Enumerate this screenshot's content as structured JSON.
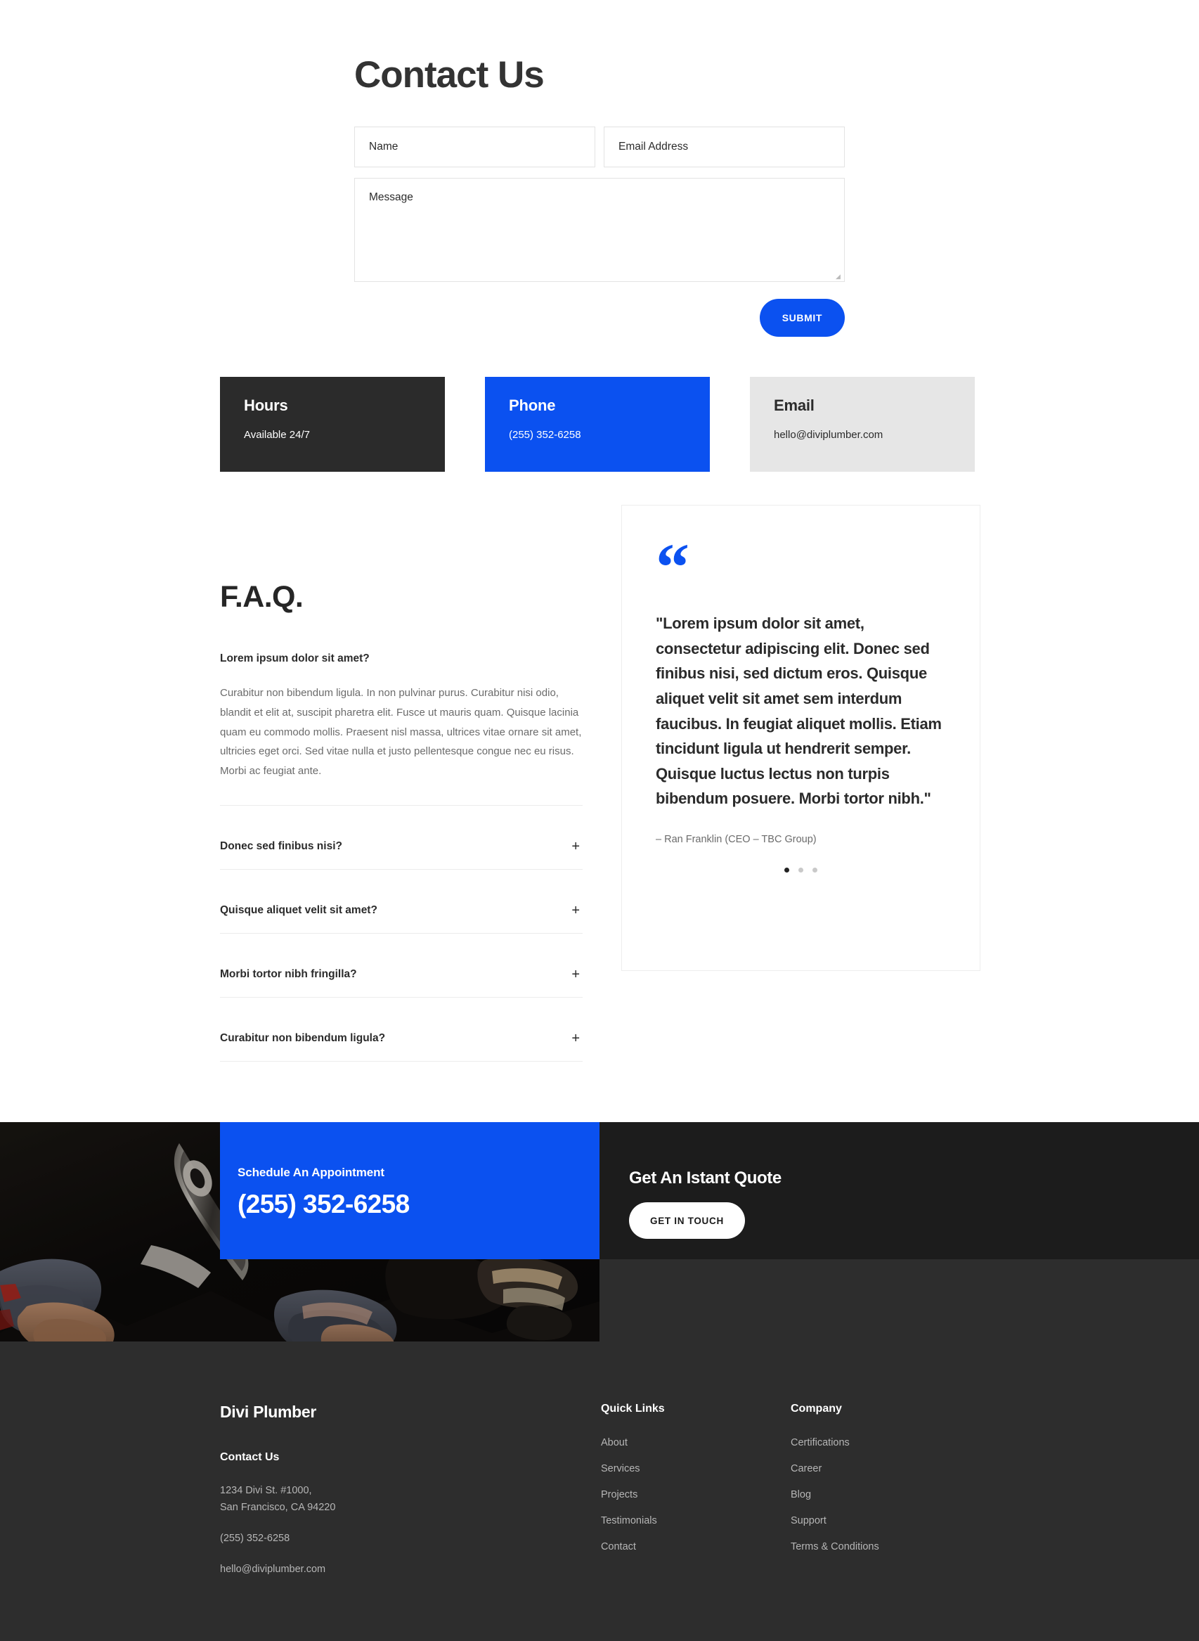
{
  "contact": {
    "title": "Contact Us",
    "form": {
      "name_placeholder": "Name",
      "email_placeholder": "Email Address",
      "message_placeholder": "Message",
      "submit_label": "SUBMIT"
    }
  },
  "info_cards": [
    {
      "heading": "Hours",
      "value": "Available 24/7",
      "style": "dark"
    },
    {
      "heading": "Phone",
      "value": "(255) 352-6258",
      "style": "blue"
    },
    {
      "heading": "Email",
      "value": "hello@diviplumber.com",
      "style": "light"
    }
  ],
  "faq": {
    "title": "F.A.Q.",
    "open_item": {
      "question": "Lorem ipsum dolor sit amet?",
      "answer": "Curabitur non bibendum ligula. In non pulvinar purus. Curabitur nisi odio, blandit et elit at, suscipit pharetra elit. Fusce ut mauris quam. Quisque lacinia quam eu commodo mollis. Praesent nisl massa, ultrices vitae ornare sit amet, ultricies eget orci. Sed vitae nulla et justo pellentesque congue nec eu risus. Morbi ac feugiat ante."
    },
    "items": [
      {
        "question": "Donec sed finibus nisi?",
        "toggle": "+"
      },
      {
        "question": "Quisque aliquet velit sit amet?",
        "toggle": "+"
      },
      {
        "question": "Morbi tortor nibh fringilla?",
        "toggle": "+"
      },
      {
        "question": "Curabitur non bibendum ligula?",
        "toggle": "+"
      }
    ]
  },
  "testimonial": {
    "quote_glyph": "“",
    "text": "\"Lorem ipsum dolor sit amet, consectetur adipiscing elit. Donec sed finibus nisi, sed dictum eros. Quisque aliquet velit sit amet sem interdum faucibus. In feugiat aliquet mollis. Etiam tincidunt ligula ut hendrerit semper. Quisque luctus lectus non turpis bibendum posuere. Morbi tortor nibh.\"",
    "author": "– Ran Franklin (CEO – TBC Group)",
    "slide_count": 3,
    "active_slide": 0
  },
  "cta": {
    "appointment_label": "Schedule An Appointment",
    "appointment_phone": "(255) 352-6258",
    "quote_heading": "Get An Istant Quote",
    "quote_button": "GET IN TOUCH"
  },
  "footer": {
    "brand": "Divi Plumber",
    "contact_heading": "Contact Us",
    "address_line1": "1234 Divi St. #1000,",
    "address_line2": "San Francisco, CA 94220",
    "phone": "(255) 352-6258",
    "email": "hello@diviplumber.com",
    "columns": [
      {
        "heading": "Quick Links",
        "links": [
          "About",
          "Services",
          "Projects",
          "Testimonials",
          "Contact"
        ]
      },
      {
        "heading": "Company",
        "links": [
          "Certifications",
          "Career",
          "Blog",
          "Support",
          "Terms & Conditions"
        ]
      }
    ]
  },
  "colors": {
    "accent_blue": "#0b51f0",
    "dark": "#2b2b2b",
    "light_gray": "#e6e6e6",
    "footer_bg": "#2d2d2d"
  }
}
